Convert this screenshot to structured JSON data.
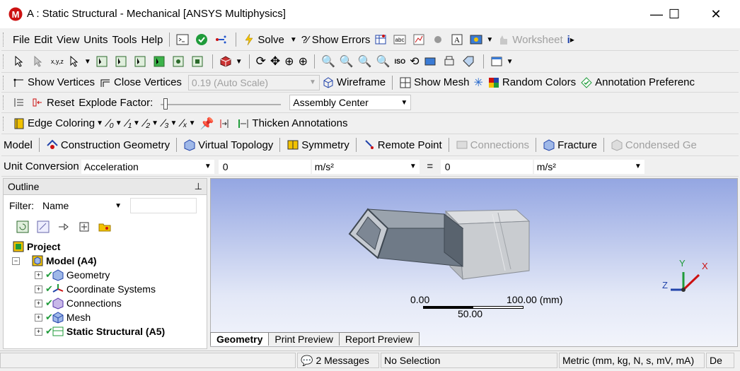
{
  "window": {
    "title": "A : Static Structural - Mechanical [ANSYS Multiphysics]",
    "minimize": "—",
    "maximize": "☐",
    "close": "✕"
  },
  "menubar": {
    "items": [
      "File",
      "Edit",
      "View",
      "Units",
      "Tools",
      "Help"
    ],
    "solve_label": "Solve",
    "show_errors_label": "?⁄ Show Errors",
    "worksheet_label": "Worksheet"
  },
  "toolbar_vertices": {
    "show_vertices": "Show Vertices",
    "close_vertices": "Close Vertices",
    "scale_value": "0.19 (Auto Scale)",
    "wireframe": "Wireframe",
    "show_mesh": "Show Mesh",
    "random_colors": "Random Colors",
    "annotation_preferences": "Annotation Preferenc"
  },
  "toolbar_explode": {
    "reset": "Reset",
    "explode_factor": "Explode Factor:",
    "assembly_center": "Assembly Center"
  },
  "toolbar_edges": {
    "edge_coloring": "Edge Coloring",
    "thicken_annotations": "Thicken Annotations"
  },
  "toolbar_context": {
    "model": "Model",
    "construction_geometry": "Construction Geometry",
    "virtual_topology": "Virtual Topology",
    "symmetry": "Symmetry",
    "remote_point": "Remote Point",
    "connections": "Connections",
    "fracture": "Fracture",
    "condensed_geometry": "Condensed Ge"
  },
  "unit_conversion": {
    "label": "Unit Conversion",
    "quantity": "Acceleration",
    "value_in": "0",
    "unit_in": "m/s²",
    "equals": "=",
    "value_out": "0",
    "unit_out": "m/s²"
  },
  "outline": {
    "title": "Outline",
    "pin": "ᵖ",
    "filter_label": "Filter:",
    "filter_value": "Name",
    "tree": {
      "project": "Project",
      "model": "Model (A4)",
      "children": [
        "Geometry",
        "Coordinate Systems",
        "Connections",
        "Mesh",
        "Static Structural (A5)"
      ]
    }
  },
  "viewport": {
    "scale_min": "0.00",
    "scale_max": "100.00 (mm)",
    "scale_mid": "50.00",
    "triad": {
      "x": "X",
      "y": "Y",
      "z": "Z"
    }
  },
  "view_tabs": [
    "Geometry",
    "Print Preview",
    "Report Preview"
  ],
  "status": {
    "messages": "2 Messages",
    "selection": "No Selection",
    "units": "Metric (mm, kg, N, s, mV, mA)",
    "extra": "De"
  },
  "colors": {
    "accent_red": "#cc1111",
    "viewport_top": "#94a6e2",
    "body_dark": "#6f7a87",
    "body_light": "#c9ccd0"
  }
}
